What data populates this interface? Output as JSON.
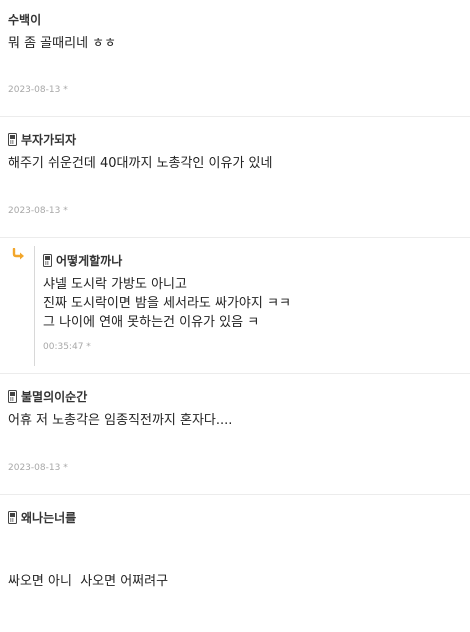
{
  "comments": [
    {
      "author": "수백이",
      "has_phone_icon": false,
      "body": [
        "뭐 좀 골때리네 ㅎㅎ"
      ],
      "date": "2023-08-13"
    },
    {
      "author": "부자가되자",
      "has_phone_icon": true,
      "body": [
        "해주기 쉬운건데 40대까지 노총각인 이유가 있네"
      ],
      "date": "2023-08-13"
    },
    {
      "author": "어떻게할까나",
      "has_phone_icon": true,
      "is_reply": true,
      "body": [
        "샤넬 도시락 가방도 아니고",
        "진짜 도시락이면 밤을 세서라도 싸가야지 ㅋㅋ",
        "그 나이에 연애 못하는건 이유가 있음 ㅋ"
      ],
      "date": "00:35:47"
    },
    {
      "author": "불멸의이순간",
      "has_phone_icon": true,
      "body": [
        "어휴 저 노총각은 임종직전까지 혼자다...."
      ],
      "date": "2023-08-13"
    },
    {
      "author": "왜나는너를",
      "has_phone_icon": true,
      "body": [
        "싸오면 아니  사오면 어쩌려구"
      ]
    }
  ],
  "date_suffix": "*",
  "icons": {
    "phone": "mobile-phone-icon",
    "reply": "reply-arrow-icon"
  },
  "colors": {
    "reply_arrow": "#f2a62b",
    "date": "#a8a8a8",
    "divider": "#ececec"
  }
}
